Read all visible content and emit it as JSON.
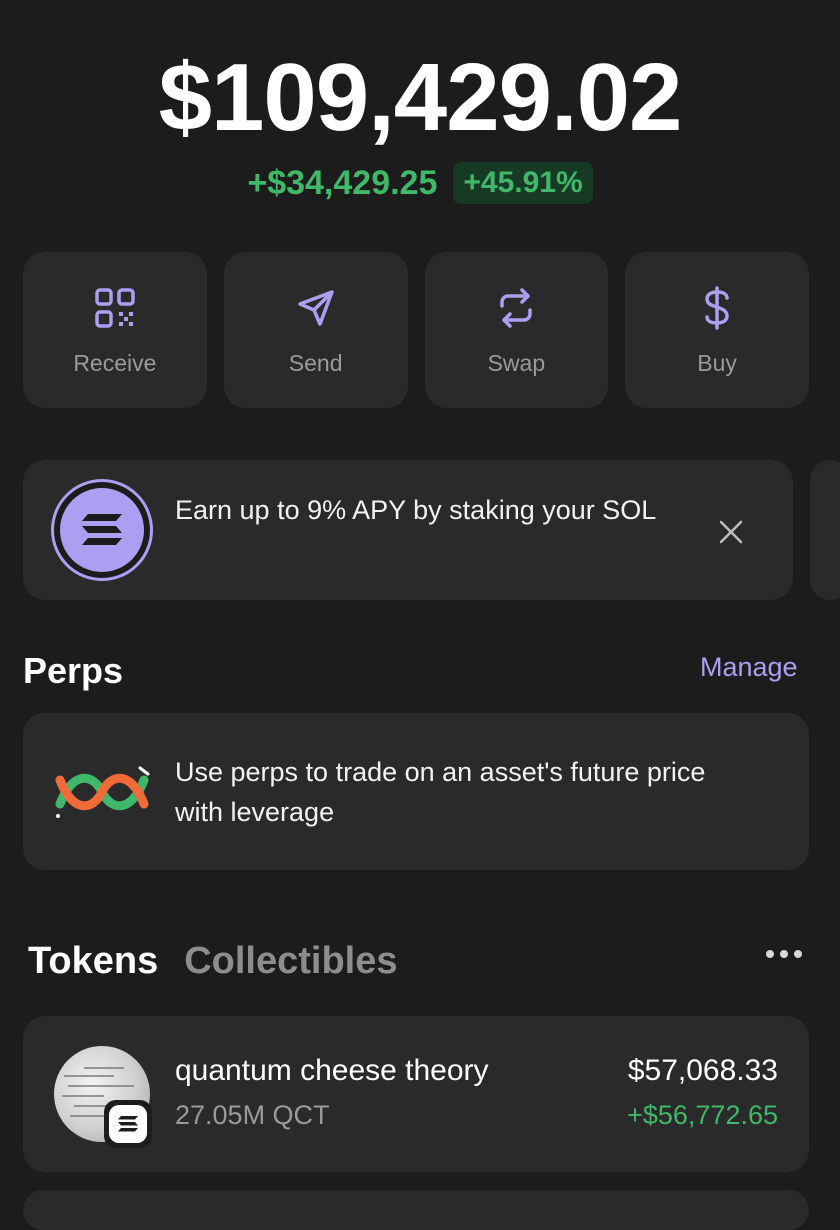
{
  "portfolio": {
    "balance": "$109,429.02",
    "change_amount": "+$34,429.25",
    "change_percent": "+45.91%"
  },
  "actions": [
    {
      "label": "Receive",
      "icon": "qr-code-icon"
    },
    {
      "label": "Send",
      "icon": "send-arrow-icon"
    },
    {
      "label": "Swap",
      "icon": "swap-arrows-icon"
    },
    {
      "label": "Buy",
      "icon": "dollar-icon"
    }
  ],
  "promo": {
    "text": "Earn up to 9% APY by staking your SOL",
    "icon": "solana-icon",
    "close_icon": "close-icon"
  },
  "perps": {
    "title": "Perps",
    "manage_label": "Manage",
    "description": "Use perps to trade on an asset's future price with leverage",
    "icon": "perps-logo-icon"
  },
  "tabs": [
    {
      "label": "Tokens",
      "active": true
    },
    {
      "label": "Collectibles",
      "active": false
    }
  ],
  "tokens": [
    {
      "name": "quantum cheese theory",
      "quantity": "27.05M QCT",
      "value": "$57,068.33",
      "change": "+$56,772.65"
    }
  ],
  "colors": {
    "background": "#1c1c1c",
    "card": "#2a2a2a",
    "accent": "#ab9ff2",
    "positive": "#3fb86a"
  }
}
